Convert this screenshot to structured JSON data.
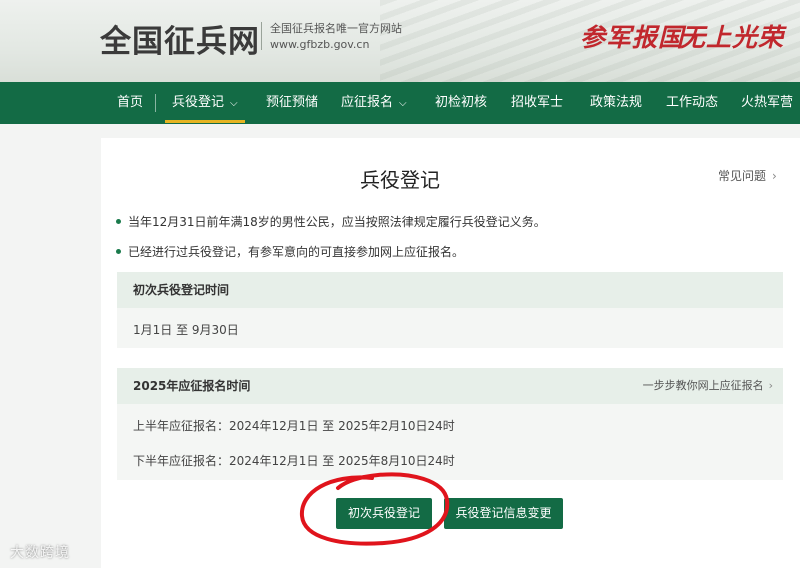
{
  "header": {
    "site_name": "全国征兵网",
    "tagline": "全国征兵报名唯一官方网站",
    "url": "www.gfbzb.gov.cn",
    "slogan_1": "参军报国",
    "slogan_2": "无上光荣"
  },
  "nav": {
    "items": [
      {
        "label": "首页"
      },
      {
        "label": "兵役登记",
        "has_dropdown": true,
        "active": true
      },
      {
        "label": "预征预储"
      },
      {
        "label": "应征报名",
        "has_dropdown": true
      },
      {
        "label": "初检初核"
      },
      {
        "label": "招收军士"
      },
      {
        "label": "政策法规"
      },
      {
        "label": "工作动态"
      },
      {
        "label": "火热军营"
      }
    ],
    "chevron": "⌵"
  },
  "main": {
    "title": "兵役登记",
    "faq_link": "常见问题",
    "arrow": "›",
    "bullets": [
      "当年12月31日前年满18岁的男性公民，应当按照法律规定履行兵役登记义务。",
      "已经进行过兵役登记，有参军意向的可直接参加网上应征报名。"
    ],
    "panel1": {
      "heading": "初次兵役登记时间",
      "text": "1月1日 至 9月30日"
    },
    "panel2": {
      "heading": "2025年应征报名时间",
      "guide_link": "一步步教你网上应征报名",
      "lines": [
        "上半年应征报名：2024年12月1日 至 2025年2月10日24时",
        "下半年应征报名：2024年12月1日 至 2025年8月10日24时"
      ]
    },
    "buttons": {
      "first_registration": "初次兵役登记",
      "info_change": "兵役登记信息变更"
    }
  },
  "watermark": "大数跨境",
  "colors": {
    "nav_green": "#136b45",
    "active_underline": "#e6b422",
    "slogan_red": "#c1272d",
    "annotation_red": "#e0141c"
  }
}
